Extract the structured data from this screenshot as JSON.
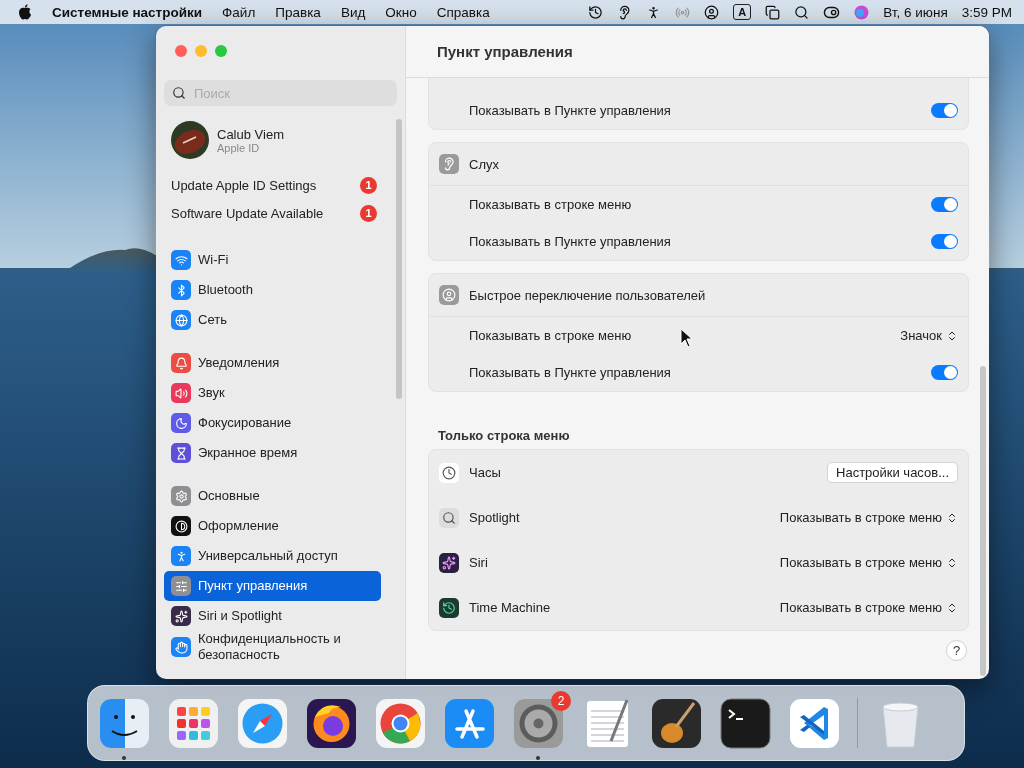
{
  "menubar": {
    "app": "Системные настройки",
    "menus": [
      "Файл",
      "Правка",
      "Вид",
      "Окно",
      "Справка"
    ],
    "input_source": "A",
    "date": "Вт, 6 июня",
    "time": "3:59 PM"
  },
  "sidebar": {
    "search": {
      "placeholder": "Поиск"
    },
    "account": {
      "name": "Calub Viem",
      "subtitle": "Apple ID"
    },
    "notices": [
      {
        "label": "Update Apple ID Settings",
        "badge": "1"
      },
      {
        "label": "Software Update Available",
        "badge": "1"
      }
    ],
    "groups": [
      {
        "items": [
          {
            "label": "Wi-Fi",
            "selected": false
          },
          {
            "label": "Bluetooth",
            "selected": false
          },
          {
            "label": "Сеть",
            "selected": false
          }
        ]
      },
      {
        "items": [
          {
            "label": "Уведомления",
            "selected": false
          },
          {
            "label": "Звук",
            "selected": false
          },
          {
            "label": "Фокусирование",
            "selected": false
          },
          {
            "label": "Экранное время",
            "selected": false
          }
        ]
      },
      {
        "items": [
          {
            "label": "Основные",
            "selected": false
          },
          {
            "label": "Оформление",
            "selected": false
          },
          {
            "label": "Универсальный доступ",
            "selected": false
          },
          {
            "label": "Пункт управления",
            "selected": true
          },
          {
            "label": "Siri и Spotlight",
            "selected": false
          },
          {
            "label": "Конфиденциальность и безопасность",
            "selected": false
          }
        ]
      }
    ]
  },
  "content": {
    "title": "Пункт управления",
    "cards": [
      {
        "rows": [
          {
            "label": "Показывать в Пункте управления",
            "kind": "toggle",
            "on": true
          }
        ]
      },
      {
        "title": "Слух",
        "rows": [
          {
            "label": "Показывать в строке меню",
            "kind": "toggle",
            "on": true
          },
          {
            "label": "Показывать в Пункте управления",
            "kind": "toggle",
            "on": true
          }
        ]
      },
      {
        "title": "Быстрое переключение пользователей",
        "rows": [
          {
            "label": "Показывать в строке меню",
            "kind": "popup",
            "value": "Значок"
          },
          {
            "label": "Показывать в Пункте управления",
            "kind": "toggle",
            "on": true
          }
        ]
      }
    ],
    "section_title": "Только строка меню",
    "menu_only": [
      {
        "label": "Часы",
        "kind": "button",
        "value": "Настройки часов..."
      },
      {
        "label": "Spotlight",
        "kind": "popup",
        "value": "Показывать в строке меню"
      },
      {
        "label": "Siri",
        "kind": "popup",
        "value": "Показывать в строке меню"
      },
      {
        "label": "Time Machine",
        "kind": "popup",
        "value": "Показывать в строке меню"
      }
    ],
    "help": "?"
  },
  "dock": {
    "items": [
      {
        "running": true
      },
      {
        "running": false
      },
      {
        "running": false
      },
      {
        "running": false
      },
      {
        "running": false
      },
      {
        "running": false
      },
      {
        "running": true,
        "badge": "2"
      },
      {
        "running": false
      },
      {
        "running": false
      },
      {
        "running": false
      },
      {
        "running": false
      },
      {
        "running": false
      }
    ]
  }
}
